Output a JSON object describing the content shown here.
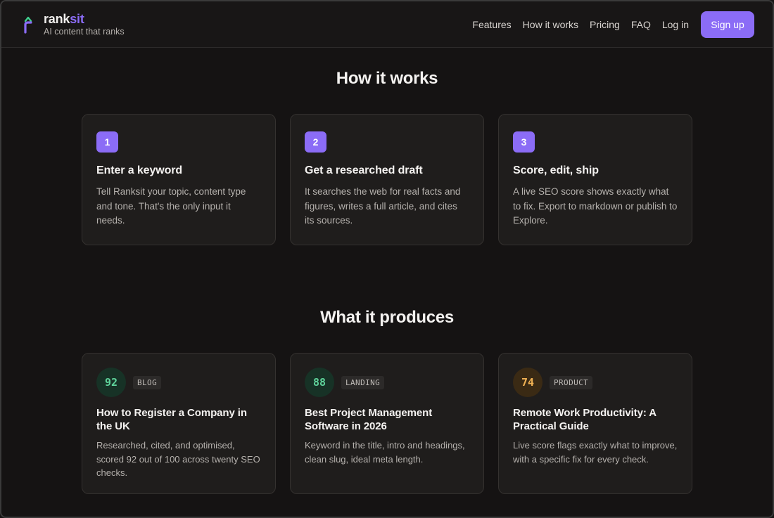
{
  "brand": {
    "name_part1": "rank",
    "name_part2": "sit",
    "tagline": "AI content that ranks",
    "logo_icon": "rank-arrow-logo",
    "accent_color": "#8b6cf6",
    "logo_secondary_color": "#3fcf8e"
  },
  "nav": {
    "links": [
      "Features",
      "How it works",
      "Pricing",
      "FAQ",
      "Log in"
    ],
    "signup_label": "Sign up"
  },
  "how_it_works": {
    "title": "How it works",
    "steps": [
      {
        "number": "1",
        "title": "Enter a keyword",
        "description": "Tell Ranksit your topic, content type and tone. That's the only input it needs."
      },
      {
        "number": "2",
        "title": "Get a researched draft",
        "description": "It searches the web for real facts and figures, writes a full article, and cites its sources."
      },
      {
        "number": "3",
        "title": "Score, edit, ship",
        "description": "A live SEO score shows exactly what to fix. Export to markdown or publish to Explore."
      }
    ]
  },
  "produces": {
    "title": "What it produces",
    "items": [
      {
        "score": "92",
        "score_color": "green",
        "type": "BLOG",
        "title": "How to Register a Company in the UK",
        "description": "Researched, cited, and optimised, scored 92 out of 100 across twenty SEO checks."
      },
      {
        "score": "88",
        "score_color": "green",
        "type": "LANDING",
        "title": "Best Project Management Software in 2026",
        "description": "Keyword in the title, intro and headings, clean slug, ideal meta length."
      },
      {
        "score": "74",
        "score_color": "amber",
        "type": "PRODUCT",
        "title": "Remote Work Productivity: A Practical Guide",
        "description": "Live score flags exactly what to improve, with a specific fix for every check."
      }
    ]
  }
}
